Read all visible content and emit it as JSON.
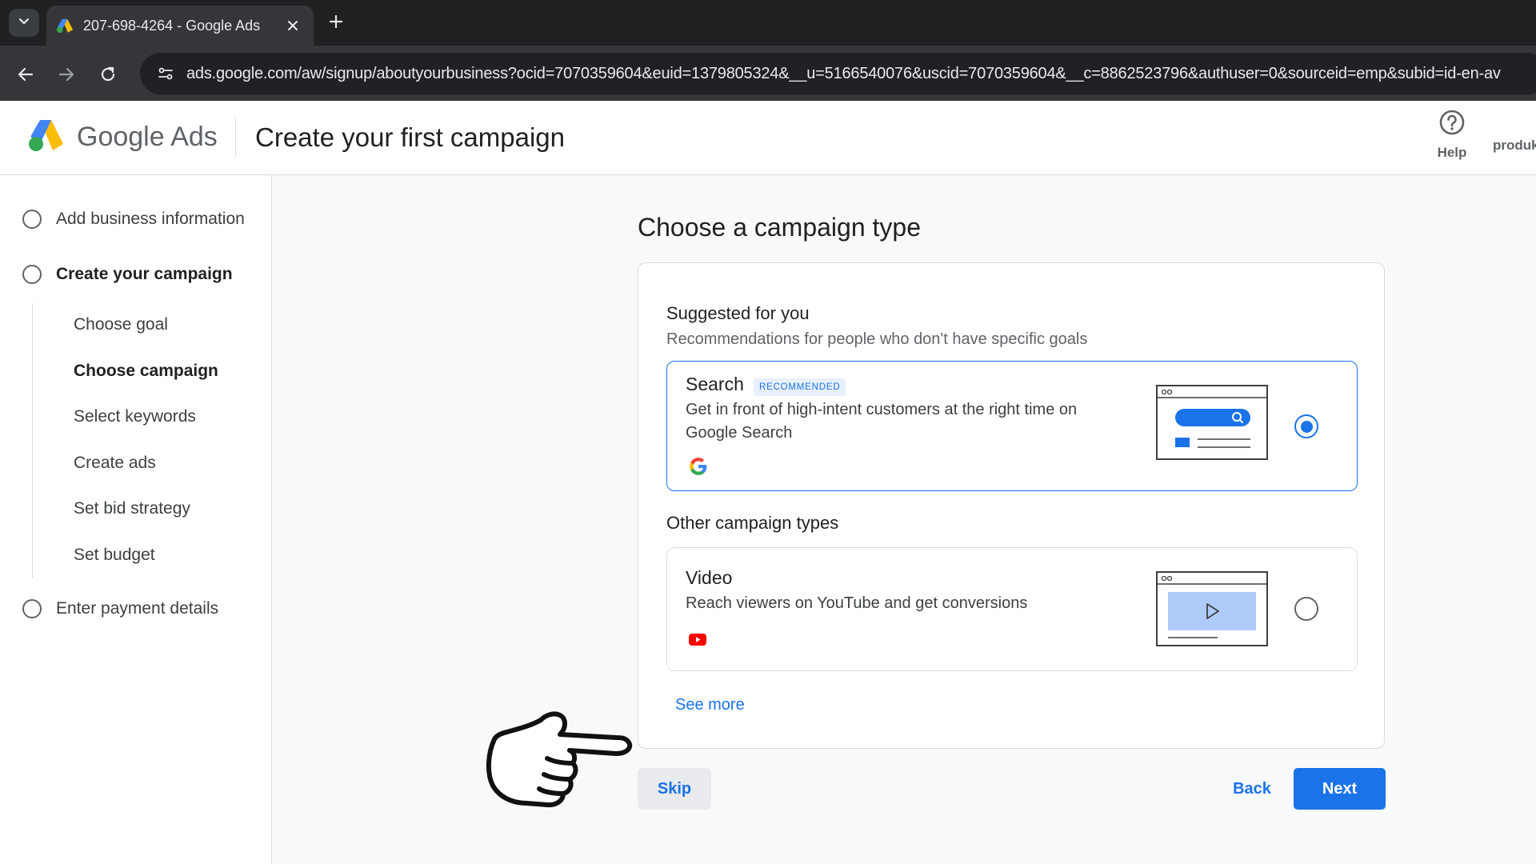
{
  "browser": {
    "tab_title": "207-698-4264 - Google Ads",
    "url": "ads.google.com/aw/signup/aboutyourbusiness?ocid=7070359604&euid=1379805324&__u=5166540076&uscid=7070359604&__c=8862523796&authuser=0&sourceid=emp&subid=id-en-av",
    "icons": [
      "chevron-down-icon",
      "google-ads-favicon",
      "close-icon",
      "plus-icon",
      "back-arrow-icon",
      "forward-arrow-icon",
      "reload-icon",
      "site-settings-icon"
    ]
  },
  "header": {
    "brand_google": "Google",
    "brand_ads": "Ads",
    "page_title": "Create your first campaign",
    "help_label": "Help",
    "account_label": "produk"
  },
  "sidebar": {
    "steps": [
      {
        "label": "Add business information"
      },
      {
        "label": "Create your campaign"
      },
      {
        "label": "Enter payment details"
      }
    ],
    "substeps": [
      {
        "label": "Choose goal"
      },
      {
        "label": "Choose campaign"
      },
      {
        "label": "Select keywords"
      },
      {
        "label": "Create ads"
      },
      {
        "label": "Set bid strategy"
      },
      {
        "label": "Set budget"
      }
    ]
  },
  "main": {
    "title": "Choose a campaign type",
    "suggested_title": "Suggested for you",
    "suggested_sub": "Recommendations for people who don't have specific goals",
    "other_title": "Other campaign types",
    "options": [
      {
        "name": "Search",
        "badge": "RECOMMENDED",
        "description": "Get in front of high-intent customers at the right time on Google Search",
        "selected": true
      },
      {
        "name": "Video",
        "description": "Reach viewers on YouTube and get conversions",
        "selected": false
      }
    ],
    "see_more": "See more",
    "skip": "Skip",
    "back": "Back",
    "next": "Next"
  },
  "colors": {
    "accent": "#1a73e8",
    "chrome_dark": "#1f2123",
    "chrome_toolbar": "#35363a"
  }
}
